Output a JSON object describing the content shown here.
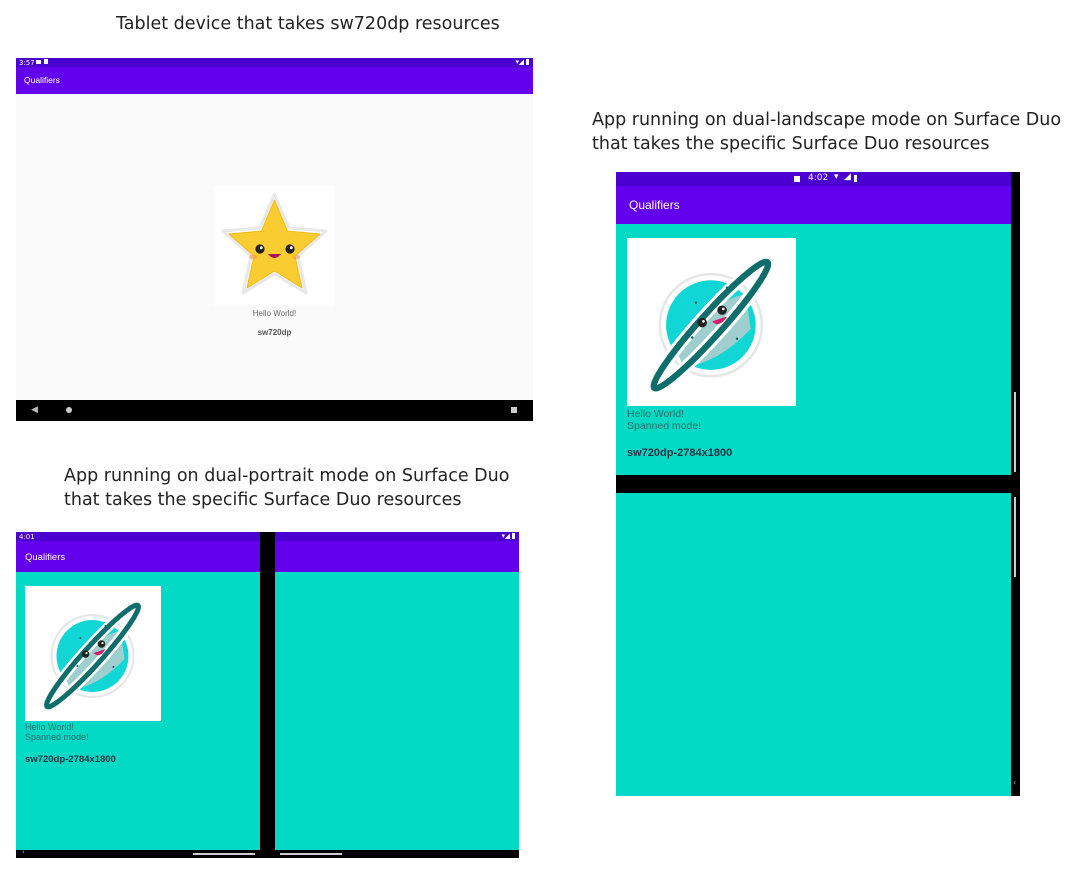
{
  "captions": {
    "tablet": "Tablet device that takes sw720dp resources",
    "landscape_line1": "App running on dual-landscape mode on Surface Duo",
    "landscape_line2": "that takes the specific Surface Duo resources",
    "portrait_line1": "App running on dual-portrait mode on Surface Duo",
    "portrait_line2": "that takes the specific Surface Duo resources"
  },
  "tablet": {
    "time": "3:57",
    "app_title": "Qualifiers",
    "hello": "Hello World!",
    "qualifier": "sw720dp",
    "image_icon": "star-emoji-icon"
  },
  "landscape": {
    "time": "4:02",
    "app_title": "Qualifiers",
    "hello": "Hello World!",
    "spanned": "Spanned mode!",
    "qualifier": "sw720dp-2784x1800",
    "image_icon": "planet-emoji-icon"
  },
  "portrait": {
    "time": "4:01",
    "app_title": "Qualifiers",
    "hello": "Hello World!",
    "spanned": "Spanned mode!",
    "qualifier": "sw720dp-2784x1800",
    "image_icon": "planet-emoji-icon"
  },
  "colors": {
    "status_bar": "#4a00cf",
    "app_bar": "#6200ee",
    "teal_background": "#03dac5",
    "tablet_background": "#fafafa"
  }
}
